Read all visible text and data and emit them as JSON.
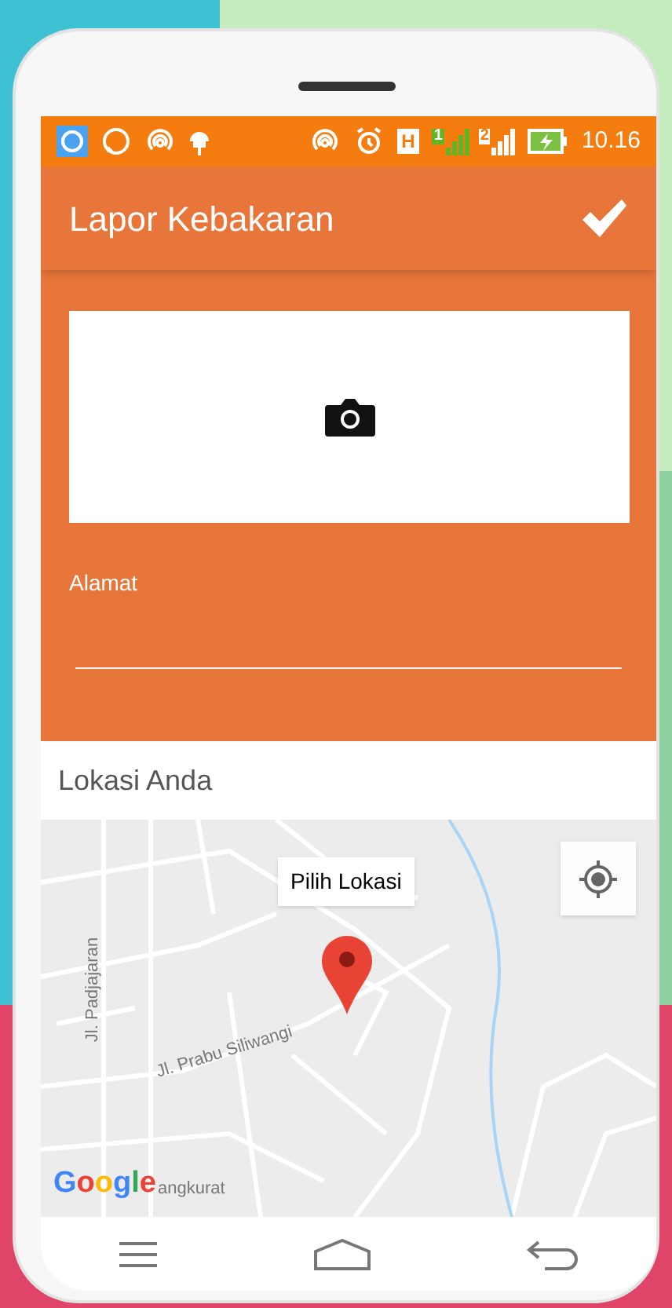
{
  "status_bar": {
    "network_type": "H",
    "sim_labels": [
      "1",
      "2"
    ],
    "time": "10.16"
  },
  "app_bar": {
    "title": "Lapor Kebakaran"
  },
  "form": {
    "address": {
      "label": "Alamat"
    }
  },
  "location": {
    "title": "Lokasi Anda",
    "marker_tooltip": "Pilih Lokasi",
    "street_labels": [
      "Jl. Padjajaran",
      "Jl. Prabu Siliwangi",
      "angkurat"
    ],
    "attribution": "Google"
  }
}
